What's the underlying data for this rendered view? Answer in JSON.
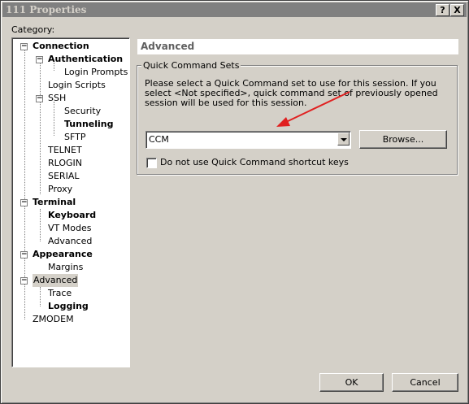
{
  "window": {
    "title": "111 Properties",
    "help_button": "?",
    "close_button": "X"
  },
  "category_label": "Category:",
  "tree": [
    {
      "label": "Connection",
      "bold": true
    },
    {
      "label": "Authentication",
      "bold": true
    },
    {
      "label": "Login Prompts",
      "bold": false
    },
    {
      "label": "Login Scripts",
      "bold": false
    },
    {
      "label": "SSH",
      "bold": false
    },
    {
      "label": "Security",
      "bold": false
    },
    {
      "label": "Tunneling",
      "bold": true
    },
    {
      "label": "SFTP",
      "bold": false
    },
    {
      "label": "TELNET",
      "bold": false
    },
    {
      "label": "RLOGIN",
      "bold": false
    },
    {
      "label": "SERIAL",
      "bold": false
    },
    {
      "label": "Proxy",
      "bold": false
    },
    {
      "label": "Terminal",
      "bold": true
    },
    {
      "label": "Keyboard",
      "bold": true
    },
    {
      "label": "VT Modes",
      "bold": false
    },
    {
      "label": "Advanced",
      "bold": false
    },
    {
      "label": "Appearance",
      "bold": true
    },
    {
      "label": "Margins",
      "bold": false
    },
    {
      "label": "Advanced",
      "bold": false,
      "selected": true
    },
    {
      "label": "Trace",
      "bold": false
    },
    {
      "label": "Logging",
      "bold": true
    },
    {
      "label": "ZMODEM",
      "bold": false
    }
  ],
  "panel": {
    "header": "Advanced",
    "group_title": "Quick Command Sets",
    "description": "Please select a Quick Command set to use for this session. If you select <Not specified>, quick command set of previously opened session will be used for this session.",
    "combo_value": "CCM",
    "browse_label": "Browse...",
    "checkbox_label": "Do not use Quick Command shortcut keys",
    "checkbox_checked": false
  },
  "footer": {
    "ok_label": "OK",
    "cancel_label": "Cancel"
  },
  "colors": {
    "arrow": "#e02020"
  }
}
